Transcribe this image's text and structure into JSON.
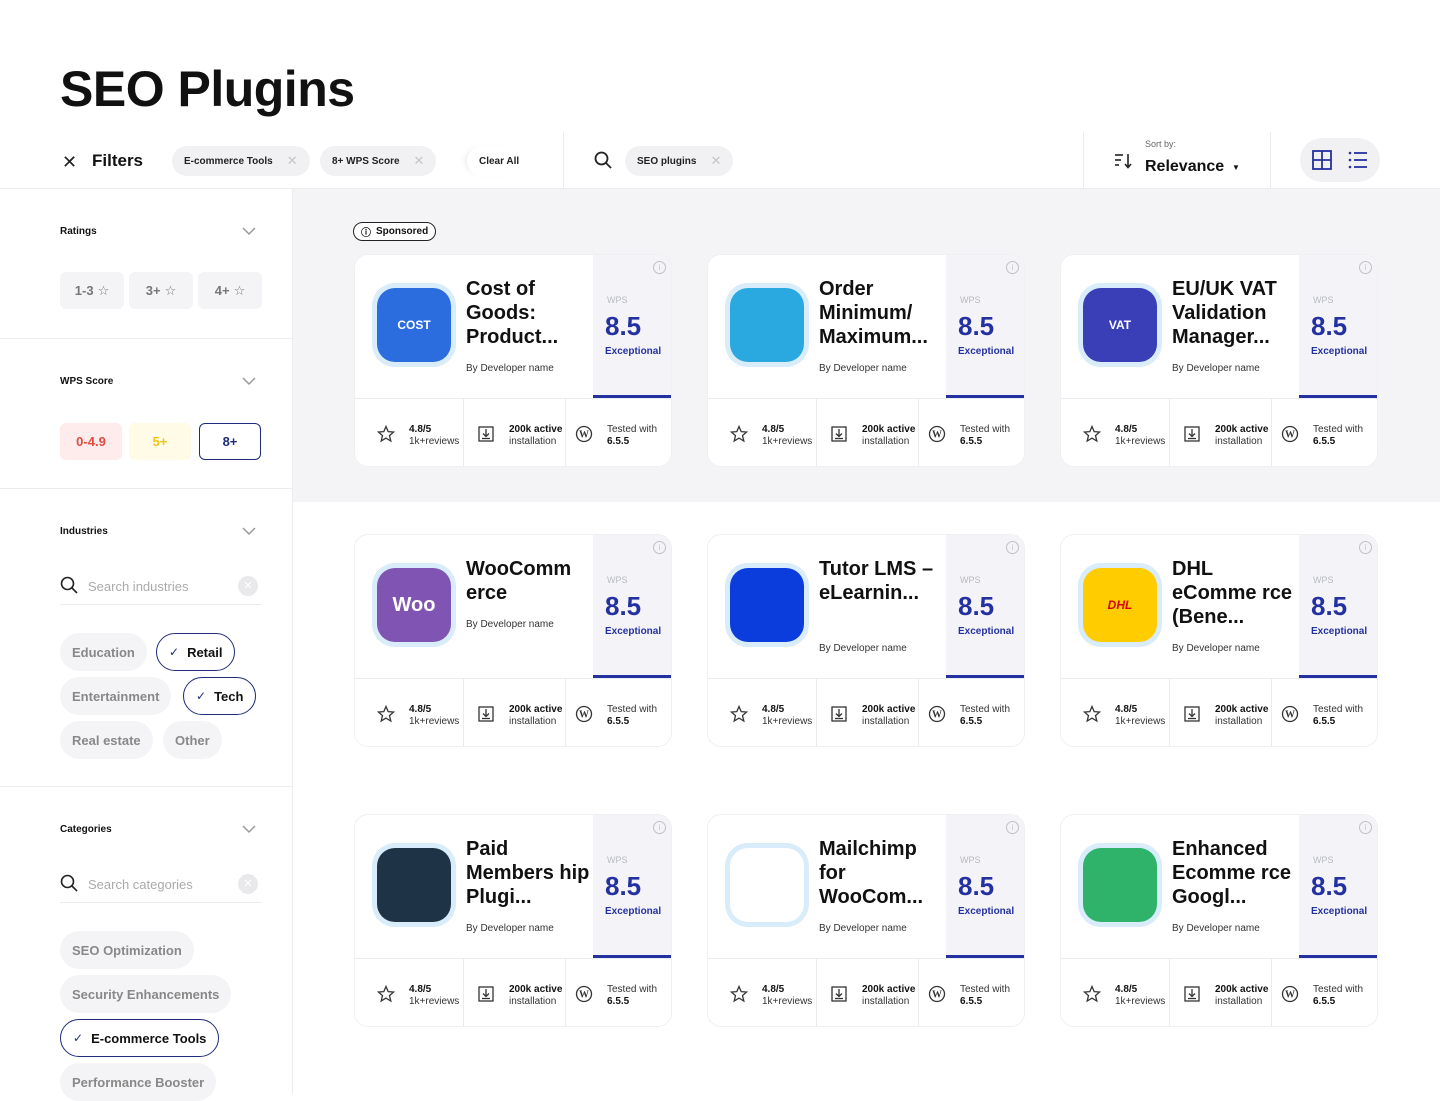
{
  "page": {
    "title": "SEO Plugins"
  },
  "toolbar": {
    "filters_label": "Filters",
    "active_chips": [
      "E-commerce Tools",
      "8+ WPS Score"
    ],
    "clear_all": "Clear All",
    "search_chip": "SEO plugins",
    "sort_label": "Sort by:",
    "sort_value": "Relevance"
  },
  "sidebar": {
    "ratings": {
      "title": "Ratings",
      "options": [
        "1-3",
        "3+",
        "4+"
      ]
    },
    "wps_score": {
      "title": "WPS Score",
      "options": [
        "0-4.9",
        "5+",
        "8+"
      ],
      "selected": "8+"
    },
    "industries": {
      "title": "Industries",
      "search_placeholder": "Search industries",
      "tags": [
        "Education",
        "Retail",
        "Entertainment",
        "Tech",
        "Real estate",
        "Other"
      ],
      "selected": [
        "Retail",
        "Tech"
      ]
    },
    "categories": {
      "title": "Categories",
      "search_placeholder": "Search categories",
      "tags": [
        "SEO Optimization",
        "Security Enhancements",
        "E-commerce Tools",
        "Performance Booster"
      ],
      "selected": [
        "E-commerce Tools"
      ]
    }
  },
  "sponsored_label": "Sponsored",
  "cards": [
    {
      "name": "Cost of Goods: Product...",
      "developer": "By Developer name",
      "wps_label": "WPS",
      "score": "8.5",
      "score_label": "Exceptional",
      "rating": "4.8/5",
      "reviews": "1k+reviews",
      "installs": "200k active",
      "installs_sub": "installation",
      "tested_label": "Tested with",
      "tested_version": "6.5.5",
      "logo_color": "#2b6cdf",
      "logo_text": "COST"
    },
    {
      "name": "Order Minimum/ Maximum...",
      "developer": "By Developer name",
      "wps_label": "WPS",
      "score": "8.5",
      "score_label": "Exceptional",
      "rating": "4.8/5",
      "reviews": "1k+reviews",
      "installs": "200k active",
      "installs_sub": "installation",
      "tested_label": "Tested with",
      "tested_version": "6.5.5",
      "logo_color": "#2aa9e0",
      "logo_text": ""
    },
    {
      "name": "EU/UK VAT Validation Manager...",
      "developer": "By Developer name",
      "wps_label": "WPS",
      "score": "8.5",
      "score_label": "Exceptional",
      "rating": "4.8/5",
      "reviews": "1k+reviews",
      "installs": "200k active",
      "installs_sub": "installation",
      "tested_label": "Tested with",
      "tested_version": "6.5.5",
      "logo_color": "#3a3fb8",
      "logo_text": "VAT"
    },
    {
      "name": "WooComm erce",
      "developer": "By Developer name",
      "wps_label": "WPS",
      "score": "8.5",
      "score_label": "Exceptional",
      "rating": "4.8/5",
      "reviews": "1k+reviews",
      "installs": "200k active",
      "installs_sub": "installation",
      "tested_label": "Tested with",
      "tested_version": "6.5.5",
      "logo_color": "#7f54b3",
      "logo_text": "Woo"
    },
    {
      "name": "Tutor LMS – eLearnin...",
      "developer": "By Developer name",
      "wps_label": "WPS",
      "score": "8.5",
      "score_label": "Exceptional",
      "rating": "4.8/5",
      "reviews": "1k+reviews",
      "installs": "200k active",
      "installs_sub": "installation",
      "tested_label": "Tested with",
      "tested_version": "6.5.5",
      "logo_color": "#0a3ddc",
      "logo_text": ""
    },
    {
      "name": "DHL eComme rce (Bene...",
      "developer": "By Developer name",
      "wps_label": "WPS",
      "score": "8.5",
      "score_label": "Exceptional",
      "rating": "4.8/5",
      "reviews": "1k+reviews",
      "installs": "200k active",
      "installs_sub": "installation",
      "tested_label": "Tested with",
      "tested_version": "6.5.5",
      "logo_color": "#ffcc00",
      "logo_text": "DHL"
    },
    {
      "name": "Paid Members hip Plugi...",
      "developer": "By Developer name",
      "wps_label": "WPS",
      "score": "8.5",
      "score_label": "Exceptional",
      "rating": "4.8/5",
      "reviews": "1k+reviews",
      "installs": "200k active",
      "installs_sub": "installation",
      "tested_label": "Tested with",
      "tested_version": "6.5.5",
      "logo_color": "#1f3347",
      "logo_text": ""
    },
    {
      "name": "Mailchimp for WooCom...",
      "developer": "By Developer name",
      "wps_label": "WPS",
      "score": "8.5",
      "score_label": "Exceptional",
      "rating": "4.8/5",
      "reviews": "1k+reviews",
      "installs": "200k active",
      "installs_sub": "installation",
      "tested_label": "Tested with",
      "tested_version": "6.5.5",
      "logo_color": "#ffffff",
      "logo_text": ""
    },
    {
      "name": "Enhanced Ecomme rce Googl...",
      "developer": "By Developer name",
      "wps_label": "WPS",
      "score": "8.5",
      "score_label": "Exceptional",
      "rating": "4.8/5",
      "reviews": "1k+reviews",
      "installs": "200k active",
      "installs_sub": "installation",
      "tested_label": "Tested with",
      "tested_version": "6.5.5",
      "logo_color": "#2fb36b",
      "logo_text": ""
    }
  ]
}
